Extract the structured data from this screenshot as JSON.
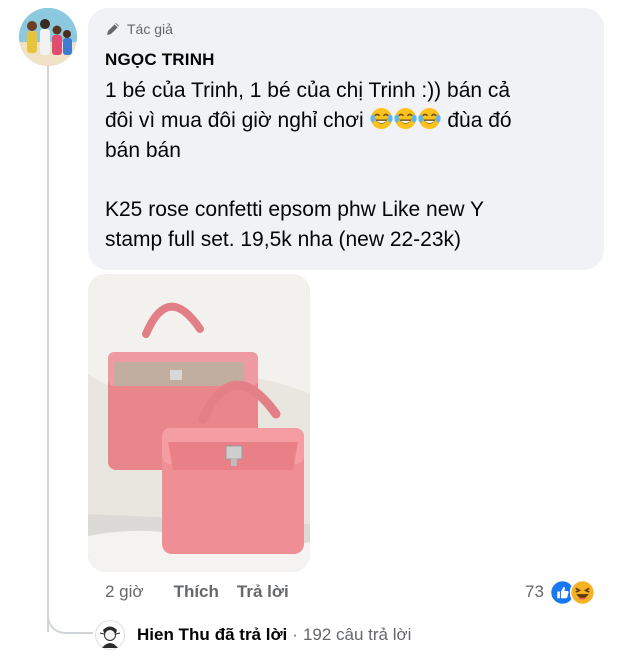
{
  "comment": {
    "author_badge": "Tác giả",
    "author_name": "NGỌC TRINH",
    "text_line1": "1 bé của Trinh, 1 bé của chị Trinh :)) bán cả",
    "text_line2_a": "đôi vì mua đôi giờ nghỉ chơi ",
    "text_line2_b": " đùa đó",
    "text_line3": "bán bán",
    "text_line4": "K25 rose confetti epsom phw Like new Y",
    "text_line5": "stamp full set. 19,5k nha (new 22-23k)",
    "emojis": [
      "tears-of-joy-emoji",
      "tears-of-joy-emoji",
      "tears-of-joy-emoji"
    ],
    "photo": "pink-handbags-photo"
  },
  "actions": {
    "time": "2 giờ",
    "like_label": "Thích",
    "reply_label": "Trả lời"
  },
  "reactions": {
    "count": "73",
    "icons": [
      "like-reaction-icon",
      "haha-reaction-icon"
    ],
    "colors": {
      "like": "#1877f2",
      "haha": "#f7b125"
    }
  },
  "reply_summary": {
    "name": "Hien Thu",
    "text": "đã trả lời",
    "separator": "·",
    "count": "192 câu trả lời"
  },
  "colors": {
    "bubble": "#f0f2f5",
    "secondary_text": "#65676b",
    "primary_text": "#050505",
    "bag_pink": "#ee8f95"
  }
}
